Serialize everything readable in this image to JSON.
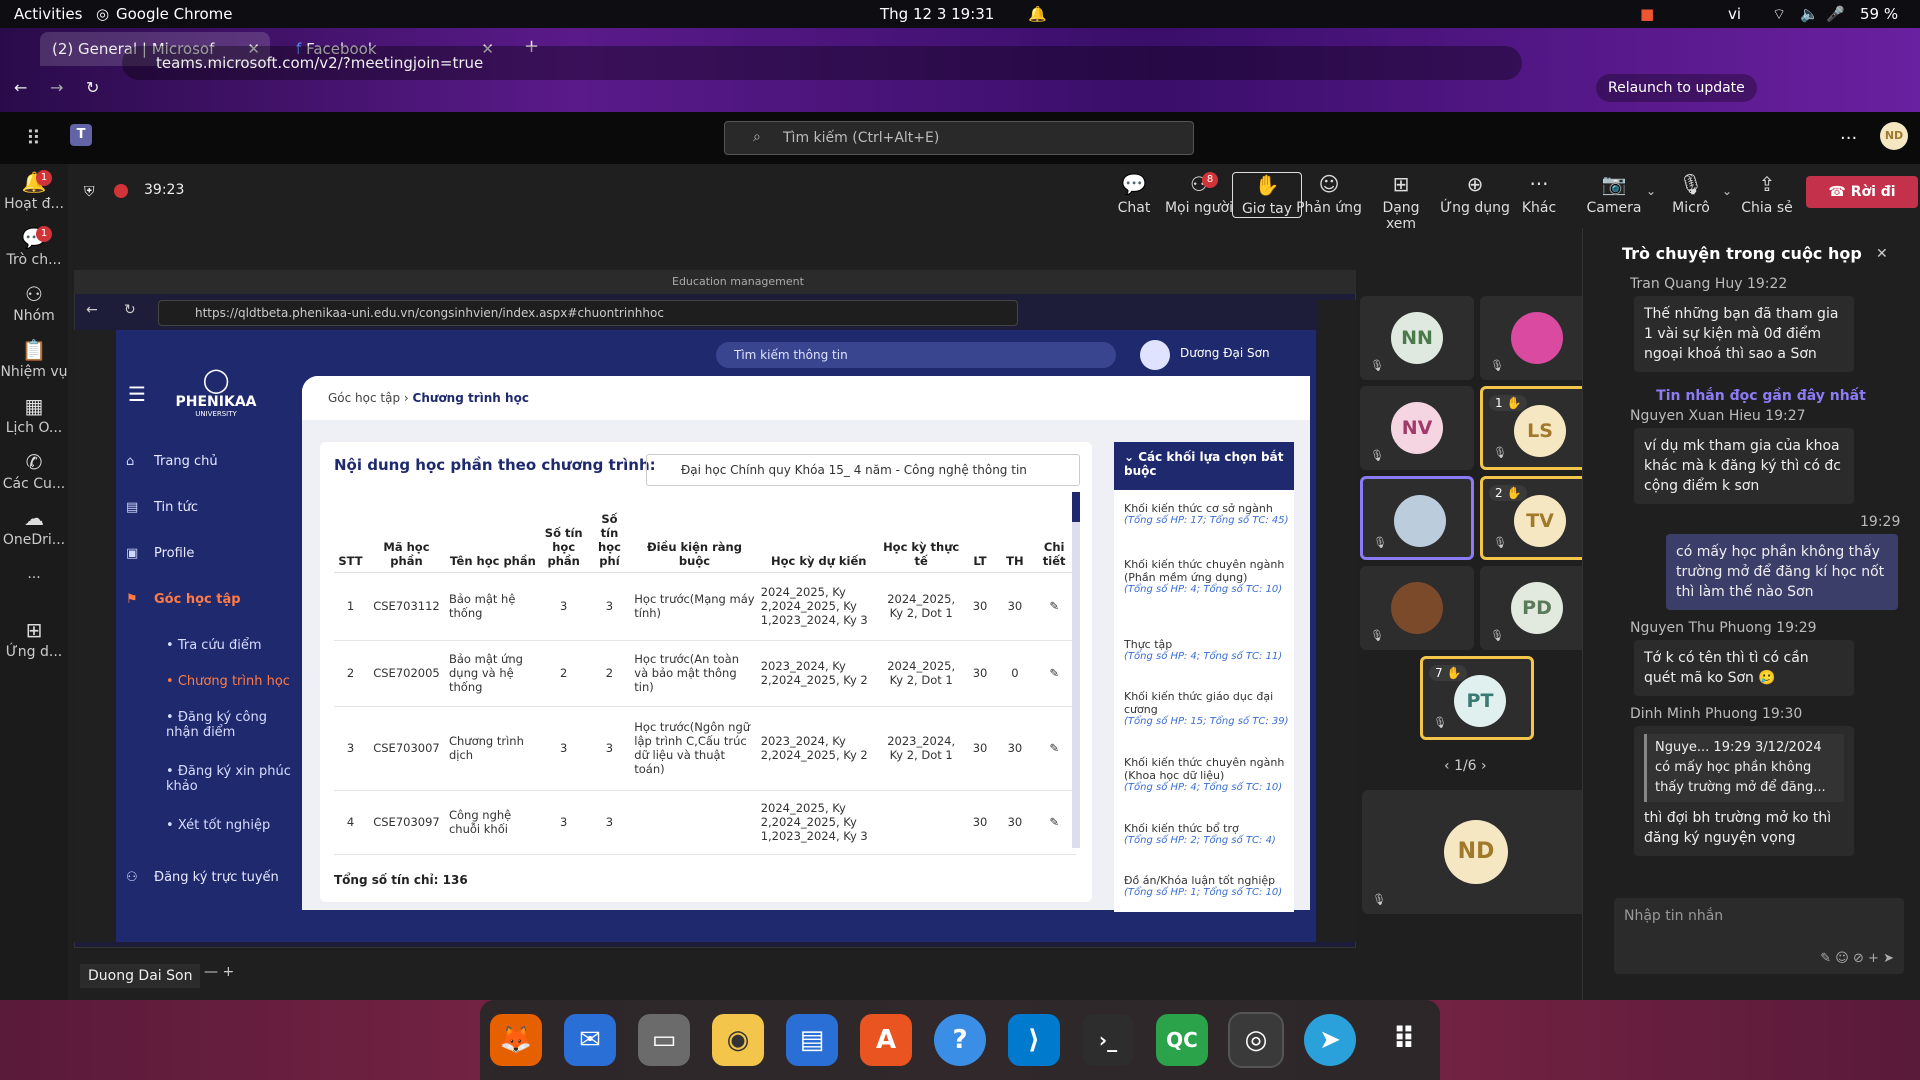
{
  "system": {
    "activities": "Activities",
    "app": "Google Chrome",
    "clock": "Thg 12 3  19:31",
    "lang": "vi",
    "battery": "59 %"
  },
  "browser": {
    "tabs": [
      {
        "label": "(2) General | Microsof"
      },
      {
        "label": "Facebook"
      }
    ],
    "url": "teams.microsoft.com/v2/?meetingjoin=true",
    "relaunch": "Relaunch to update"
  },
  "teams": {
    "search_placeholder": "Tìm kiếm (Ctrl+Alt+E)",
    "user_initials": "ND",
    "rail": [
      {
        "label": "Hoạt đ...",
        "badge": "1"
      },
      {
        "label": "Trò ch...",
        "badge": "1"
      },
      {
        "label": "Nhóm"
      },
      {
        "label": "Nhiệm vụ"
      },
      {
        "label": "Lịch O..."
      },
      {
        "label": "Các Cu..."
      },
      {
        "label": "OneDri..."
      },
      {
        "label": "..."
      },
      {
        "label": "Ứng d..."
      }
    ],
    "timer": "39:23",
    "meeting_buttons": [
      {
        "label": "Chat"
      },
      {
        "label": "Mọi người",
        "badge": "8"
      },
      {
        "label": "Giơ tay"
      },
      {
        "label": "Phản ứng"
      },
      {
        "label": "Dạng xem"
      },
      {
        "label": "Ứng dụng"
      },
      {
        "label": "Khác"
      },
      {
        "label": "Camera"
      },
      {
        "label": "Micrô"
      },
      {
        "label": "Chia sẻ"
      }
    ],
    "leave": "Rời đi",
    "presenter_name": "Duong Dai Son"
  },
  "shared": {
    "window_title": "Education management",
    "url": "https://qldtbeta.phenikaa-uni.edu.vn/congsinhvien/index.aspx#chuontrinhhoc",
    "portal_search": "Tìm kiếm thông tin",
    "portal_user": "Dương Đại Sơn",
    "logo": "PHENIKAA",
    "logo_sub": "UNIVERSITY",
    "nav": [
      "Trang chủ",
      "Tin tức",
      "Profile",
      "Góc học tập",
      "Đăng ký trực tuyến"
    ],
    "subnav": [
      "Tra cứu điểm",
      "Chương trình học",
      "Đăng ký công nhận điểm",
      "Đăng ký xin phúc khảo",
      "Xét tốt nghiệp"
    ],
    "breadcrumb": [
      "Góc học tập",
      "Chương trình học"
    ],
    "card_title": "Nội dung học phần theo chương trình:",
    "program": "Đại học Chính quy Khóa 15_ 4 năm - Công nghệ thông tin",
    "columns": [
      "STT",
      "Mã học phần",
      "Tên học phần",
      "Số tín học phần",
      "Số tín học phí",
      "Điều kiện ràng buộc",
      "Học kỳ dự kiến",
      "Học kỳ thực tế",
      "LT",
      "TH",
      "Chi tiết"
    ],
    "rows": [
      [
        "1",
        "CSE703112",
        "Bảo mật hệ thống",
        "3",
        "3",
        "Học trước(Mạng máy tính)",
        "2024_2025, Ky 2,2024_2025, Ky 1,2023_2024, Ky 3",
        "2024_2025, Ky 2, Dot 1",
        "30",
        "30"
      ],
      [
        "2",
        "CSE702005",
        "Bảo mật ứng dụng và hệ thống",
        "2",
        "2",
        "Học trước(An toàn và bảo mật thông tin)",
        "2023_2024, Ky 2,2024_2025, Ky 2",
        "2024_2025, Ky 2, Dot 1",
        "30",
        "0"
      ],
      [
        "3",
        "CSE703007",
        "Chương trình dịch",
        "3",
        "3",
        "Học trước(Ngôn ngữ lập trình C,Cấu trúc dữ liệu và thuật toán)",
        "2023_2024, Ky 2,2024_2025, Ky 2",
        "2023_2024, Ky 2, Dot 1",
        "30",
        "30"
      ],
      [
        "4",
        "CSE703097",
        "Công nghệ chuỗi khối",
        "3",
        "3",
        "",
        "2024_2025, Ky 2,2024_2025, Ky 1,2023_2024, Ky 3",
        "",
        "30",
        "30"
      ]
    ],
    "total": "Tổng số tín chỉ: 136",
    "blocks_title": "Các khối lựa chọn bắt buộc",
    "blocks": [
      {
        "name": "Khối kiến thức cơ sở ngành",
        "stat": "(Tổng số HP: 17; Tổng số TC: 45)"
      },
      {
        "name": "Khối kiến thức chuyên ngành (Phần mềm ứng dụng)",
        "stat": "(Tổng số HP: 4; Tổng số TC: 10)"
      },
      {
        "name": "Thực tập",
        "stat": "(Tổng số HP: 4; Tổng số TC: 11)"
      },
      {
        "name": "Khối kiến thức giáo dục đại cương",
        "stat": "(Tổng số HP: 15; Tổng số TC: 39)"
      },
      {
        "name": "Khối kiến thức chuyên ngành (Khoa học dữ liệu)",
        "stat": "(Tổng số HP: 4; Tổng số TC: 10)"
      },
      {
        "name": "Khối kiến thức bổ trợ",
        "stat": "(Tổng số HP: 2; Tổng số TC: 4)"
      },
      {
        "name": "Đồ án/Khóa luận tốt nghiệp",
        "stat": "(Tổng số HP: 1; Tổng số TC: 10)"
      }
    ]
  },
  "participants": [
    {
      "initials": "NN",
      "bg": "#dfe9df",
      "fg": "#4a7a4a"
    },
    {
      "initials": "",
      "bg": "#d94aa0",
      "fg": "#fff"
    },
    {
      "initials": "NV",
      "bg": "#f6d5e3",
      "fg": "#a03a6a"
    },
    {
      "initials": "LS",
      "bg": "#f6e7c3",
      "fg": "#a07a2a",
      "hand": "1 ✋"
    },
    {
      "initials": "",
      "bg": "#bcd",
      "fg": "#333"
    },
    {
      "initials": "TV",
      "bg": "#f6e7c3",
      "fg": "#a07a2a",
      "hand": "2 ✋"
    },
    {
      "initials": "",
      "bg": "#7a4a2a",
      "fg": "#fff"
    },
    {
      "initials": "PD",
      "bg": "#e2eadf",
      "fg": "#5a7a5a"
    },
    {
      "initials": "PT",
      "bg": "#dff0ee",
      "fg": "#3a7a72",
      "hand": "7 ✋"
    }
  ],
  "pager": "1/6",
  "self_initials": "ND",
  "chat": {
    "title": "Trò chuyện trong cuộc họp",
    "messages": [
      {
        "sender": "Tran Quang Huy 19:22",
        "text": "Thế những bạn đã tham gia 1 vài sự kiện mà 0đ điểm ngoại khoá thì sao a Sơn"
      },
      {
        "divider": "Tin nhắn đọc gần đây nhất"
      },
      {
        "sender": "Nguyen Xuan Hieu  19:27",
        "text": "ví dụ mk tham gia của khoa khác mà k đăng ký thì có đc cộng điểm k sơn"
      },
      {
        "time": "19:29",
        "text": "có mấy học phần không thấy trường mở để đăng kí học nốt thì làm thế nào Sơn",
        "mine": true
      },
      {
        "sender": "Nguyen Thu Phuong  19:29",
        "text": "Tớ k có tên thì tì có cần quét mã ko Sơn 🥲"
      },
      {
        "sender": "Dinh Minh Phuong  19:30",
        "quote": "Nguye...  19:29 3/12/2024  có mấy học phần không thấy trường mở để đăng...",
        "text": "thì đợi bh trường mở ko thì đăng ký nguyện vọng"
      }
    ],
    "input_placeholder": "Nhập tin nhắn"
  },
  "dock": [
    {
      "name": "firefox",
      "bg": "#e66000",
      "glyph": "🦊"
    },
    {
      "name": "thunderbird",
      "bg": "#2a6fd6",
      "glyph": "✉"
    },
    {
      "name": "files",
      "bg": "#6b6b6b",
      "glyph": "▭"
    },
    {
      "name": "rhythmbox",
      "bg": "#f3c64b",
      "glyph": "◉"
    },
    {
      "name": "writer",
      "bg": "#2a6fd6",
      "glyph": "▤"
    },
    {
      "name": "app-center",
      "bg": "#e95420",
      "glyph": "A"
    },
    {
      "name": "help",
      "bg": "#3a8ee6",
      "glyph": "?"
    },
    {
      "name": "vscode",
      "bg": "#007acc",
      "glyph": "⟩"
    },
    {
      "name": "terminal",
      "bg": "#2d2d2d",
      "glyph": "›_"
    },
    {
      "name": "qc",
      "bg": "#2aa34a",
      "glyph": "QC"
    },
    {
      "name": "chrome",
      "bg": "#3a3a3a",
      "glyph": "◎"
    },
    {
      "name": "telegram",
      "bg": "#2aa1da",
      "glyph": "➤"
    },
    {
      "name": "app-grid",
      "bg": "transparent",
      "glyph": "⠿"
    }
  ]
}
